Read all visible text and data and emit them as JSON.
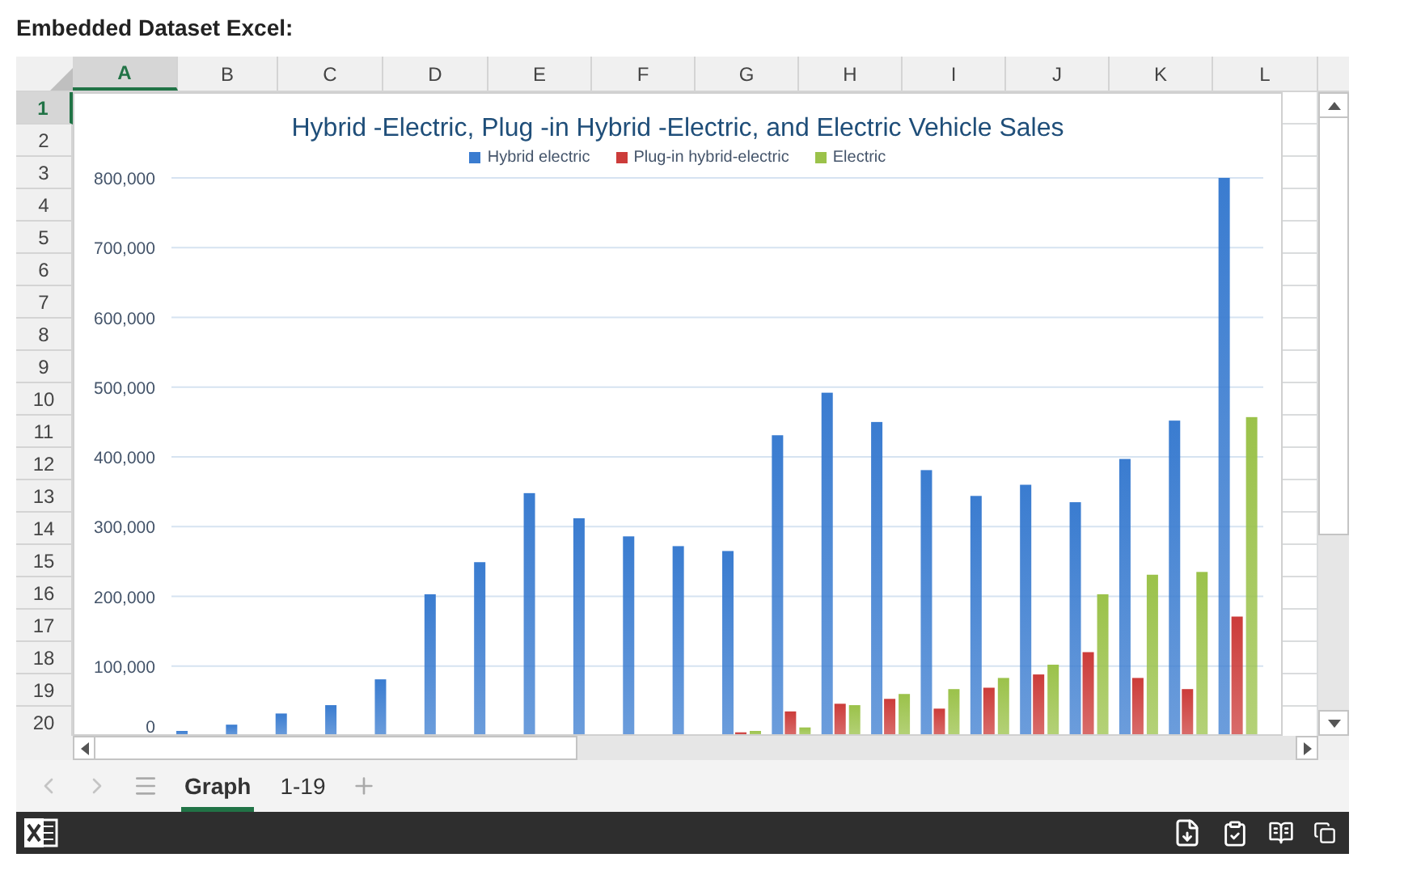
{
  "heading": "Embedded Dataset Excel:",
  "columns": [
    {
      "label": "A",
      "selected": true
    },
    {
      "label": "B",
      "selected": false
    },
    {
      "label": "C",
      "selected": false
    },
    {
      "label": "D",
      "selected": false
    },
    {
      "label": "E",
      "selected": false
    },
    {
      "label": "F",
      "selected": false
    },
    {
      "label": "G",
      "selected": false
    },
    {
      "label": "H",
      "selected": false
    },
    {
      "label": "I",
      "selected": false
    },
    {
      "label": "J",
      "selected": false
    },
    {
      "label": "K",
      "selected": false
    },
    {
      "label": "L",
      "selected": false
    }
  ],
  "rows": [
    {
      "label": "1",
      "selected": true
    },
    {
      "label": "2",
      "selected": false
    },
    {
      "label": "3",
      "selected": false
    },
    {
      "label": "4",
      "selected": false
    },
    {
      "label": "5",
      "selected": false
    },
    {
      "label": "6",
      "selected": false
    },
    {
      "label": "7",
      "selected": false
    },
    {
      "label": "8",
      "selected": false
    },
    {
      "label": "9",
      "selected": false
    },
    {
      "label": "10",
      "selected": false
    },
    {
      "label": "11",
      "selected": false
    },
    {
      "label": "12",
      "selected": false
    },
    {
      "label": "13",
      "selected": false
    },
    {
      "label": "14",
      "selected": false
    },
    {
      "label": "15",
      "selected": false
    },
    {
      "label": "16",
      "selected": false
    },
    {
      "label": "17",
      "selected": false
    },
    {
      "label": "18",
      "selected": false
    },
    {
      "label": "19",
      "selected": false
    },
    {
      "label": "20",
      "selected": false
    }
  ],
  "chart": {
    "chart_data": {
      "type": "bar",
      "title": "Hybrid -Electric, Plug -in Hybrid -Electric, and Electric Vehicle Sales",
      "ylim": [
        0,
        800000
      ],
      "grid": true,
      "legend": true,
      "yticks": [
        {
          "value": 0,
          "label": "0"
        },
        {
          "value": 100000,
          "label": "100,000"
        },
        {
          "value": 200000,
          "label": "200,000"
        },
        {
          "value": 300000,
          "label": "300,000"
        },
        {
          "value": 400000,
          "label": "400,000"
        },
        {
          "value": 500000,
          "label": "500,000"
        },
        {
          "value": 600000,
          "label": "600,000"
        },
        {
          "value": 700000,
          "label": "700,000"
        },
        {
          "value": 800000,
          "label": "800,000"
        }
      ],
      "series": [
        {
          "name": "Hybrid electric",
          "color": "#3a7cd0",
          "values": [
            7000,
            16000,
            32000,
            44000,
            81000,
            203000,
            249000,
            348000,
            312000,
            286000,
            272000,
            265000,
            431000,
            492000,
            450000,
            381000,
            344000,
            360000,
            335000,
            397000,
            452000,
            800000
          ]
        },
        {
          "name": "Plug-in hybrid-electric",
          "color": "#cc3c3a",
          "values": [
            null,
            null,
            null,
            null,
            null,
            null,
            null,
            null,
            null,
            null,
            null,
            5000,
            35000,
            46000,
            53000,
            39000,
            69000,
            88000,
            120000,
            83000,
            67000,
            171000
          ]
        },
        {
          "name": "Electric",
          "color": "#9bc24a",
          "values": [
            null,
            null,
            null,
            null,
            null,
            null,
            null,
            null,
            null,
            null,
            null,
            7000,
            12000,
            44000,
            60000,
            67000,
            83000,
            102000,
            203000,
            231000,
            235000,
            457000
          ]
        }
      ]
    }
  },
  "sheet_tabs": [
    {
      "label": "Graph",
      "selected": true
    },
    {
      "label": "1-19",
      "selected": false
    }
  ]
}
